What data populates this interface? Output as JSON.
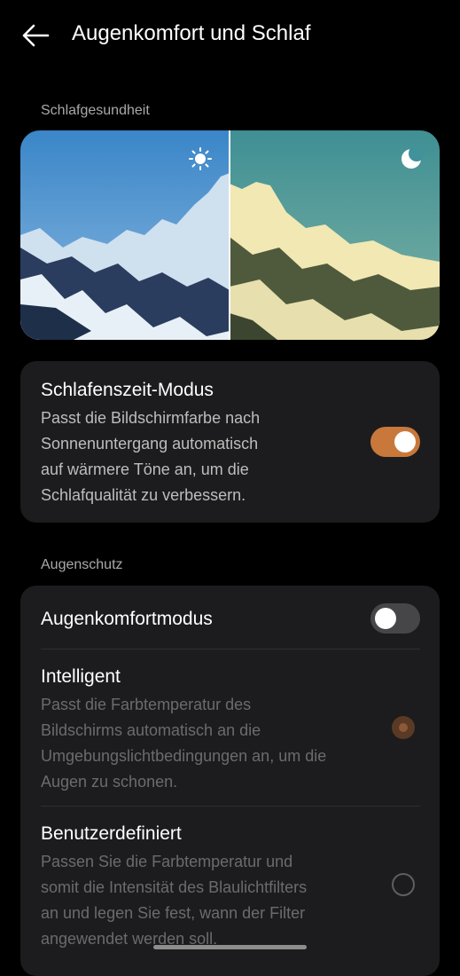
{
  "header": {
    "title": "Augenkomfort und Schlaf",
    "back_icon": "arrow-left-icon"
  },
  "sleep_section": {
    "label": "Schlafgesundheit",
    "hero": {
      "day_icon": "sun-icon",
      "night_icon": "moon-icon"
    }
  },
  "bedtime": {
    "title": "Schlafenszeit-Modus",
    "desc_lines": [
      "Passt die Bildschirmfarbe nach",
      "Sonnenuntergang automatisch",
      "auf wärmere Töne an, um die",
      "Schlafqualität zu verbessern."
    ],
    "enabled": true
  },
  "eye_section": {
    "label": "Augenschutz",
    "comfort_mode": {
      "title": "Augenkomfortmodus",
      "enabled": false
    },
    "intelligent": {
      "title": "Intelligent",
      "desc_lines": [
        "Passt die Farbtemperatur des",
        "Bildschirms automatisch an die",
        "Umgebungslichtbedingungen an, um die",
        "Augen zu schonen."
      ],
      "selected": true
    },
    "custom": {
      "title": "Benutzerdefiniert",
      "desc_lines": [
        "Passen Sie die Farbtemperatur und",
        "somit die Intensität des Blaulichtfilters",
        "an und legen Sie fest, wann der Filter",
        "angewendet werden soll."
      ],
      "selected": false
    }
  },
  "colors": {
    "accent": "#c8783a",
    "card": "#1c1c1e",
    "background": "#000000"
  }
}
